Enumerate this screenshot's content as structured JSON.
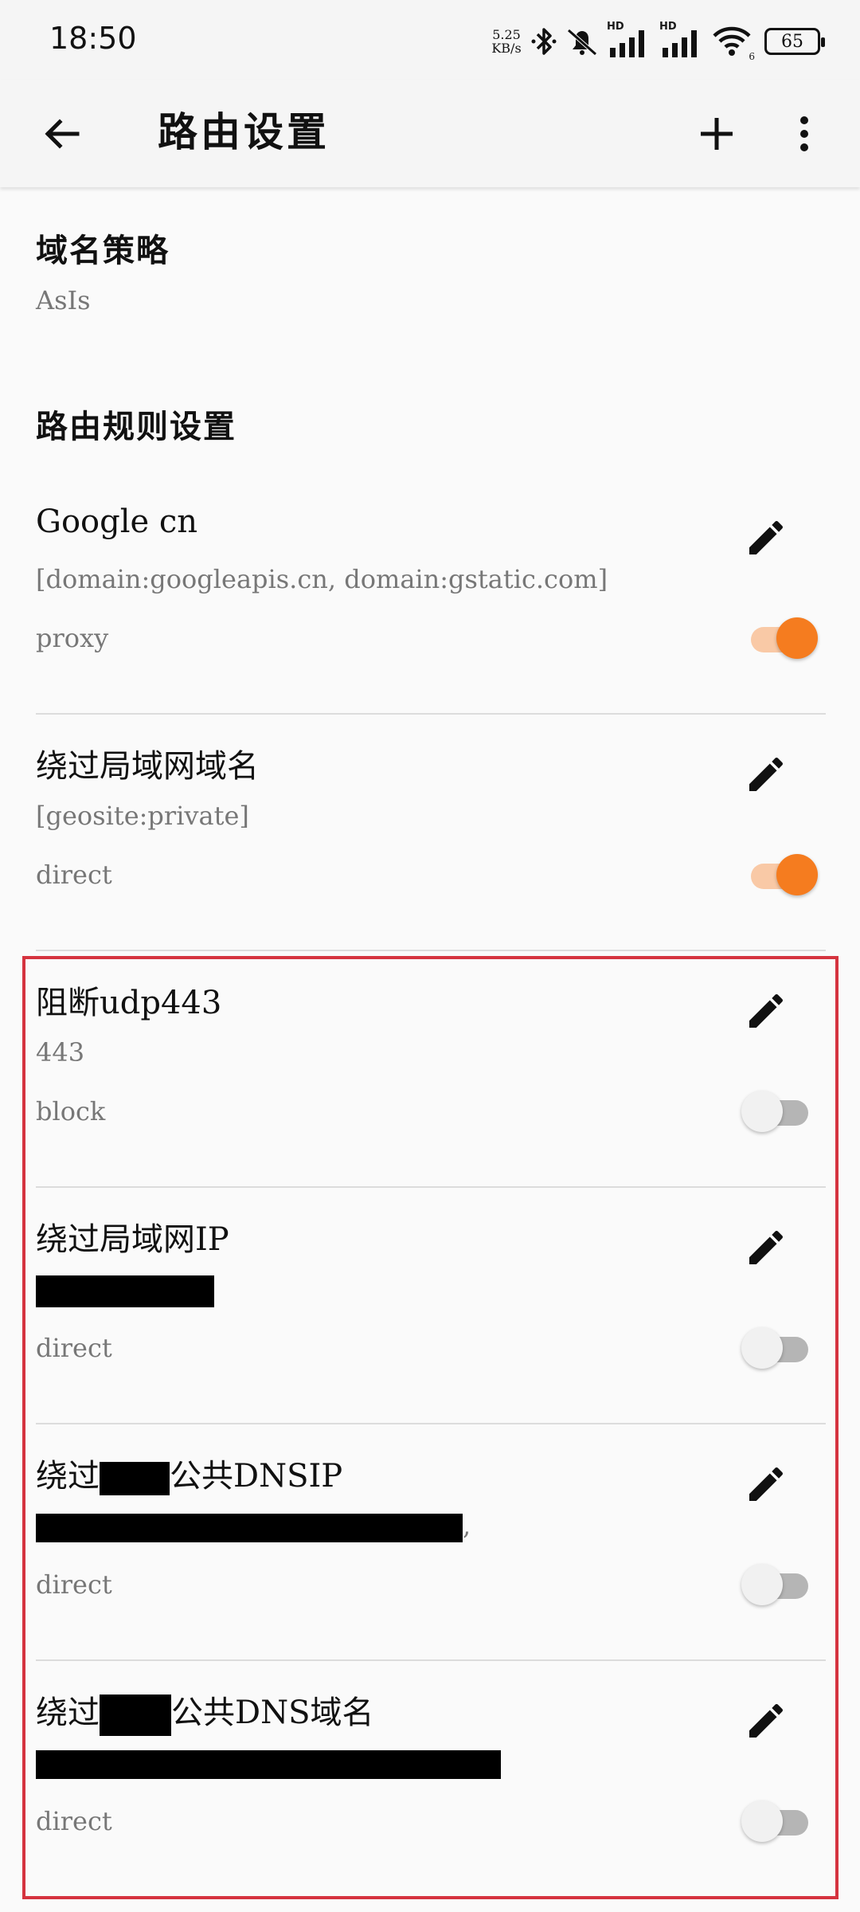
{
  "status_bar": {
    "time": "18:50",
    "net_speed_value": "5.25",
    "net_speed_unit": "KB/s",
    "hd_label_1": "HD",
    "hd_label_2": "HD",
    "wifi_sub": "6",
    "battery": "65"
  },
  "app_bar": {
    "title": "路由设置",
    "back_icon": "arrow-back-icon",
    "add_icon": "plus-icon",
    "more_icon": "more-vert-icon"
  },
  "domain_strategy": {
    "title": "域名策略",
    "value": "AsIs"
  },
  "rules_section": {
    "title": "路由规则设置"
  },
  "rules": [
    {
      "name": "Google cn",
      "desc": "[domain:googleapis.cn, domain:gstatic.com]",
      "target": "proxy",
      "enabled": true
    },
    {
      "name": "绕过局域网域名",
      "desc": "[geosite:private]",
      "target": "direct",
      "enabled": true
    },
    {
      "name": "阻断udp443",
      "desc": "443",
      "target": "block",
      "enabled": false
    },
    {
      "name": "绕过局域网IP",
      "desc": "",
      "target": "direct",
      "enabled": false
    },
    {
      "name_prefix": "绕过",
      "name_suffix": "公共DNSIP",
      "desc_tail": ",",
      "target": "direct",
      "enabled": false
    },
    {
      "name_prefix": "绕过",
      "name_suffix": "公共DNS域名",
      "desc": "",
      "target": "direct",
      "enabled": false
    }
  ],
  "colors": {
    "accent": "#f57c1f",
    "accent_track": "#f9c9a6",
    "highlight_border": "#d5333f"
  }
}
